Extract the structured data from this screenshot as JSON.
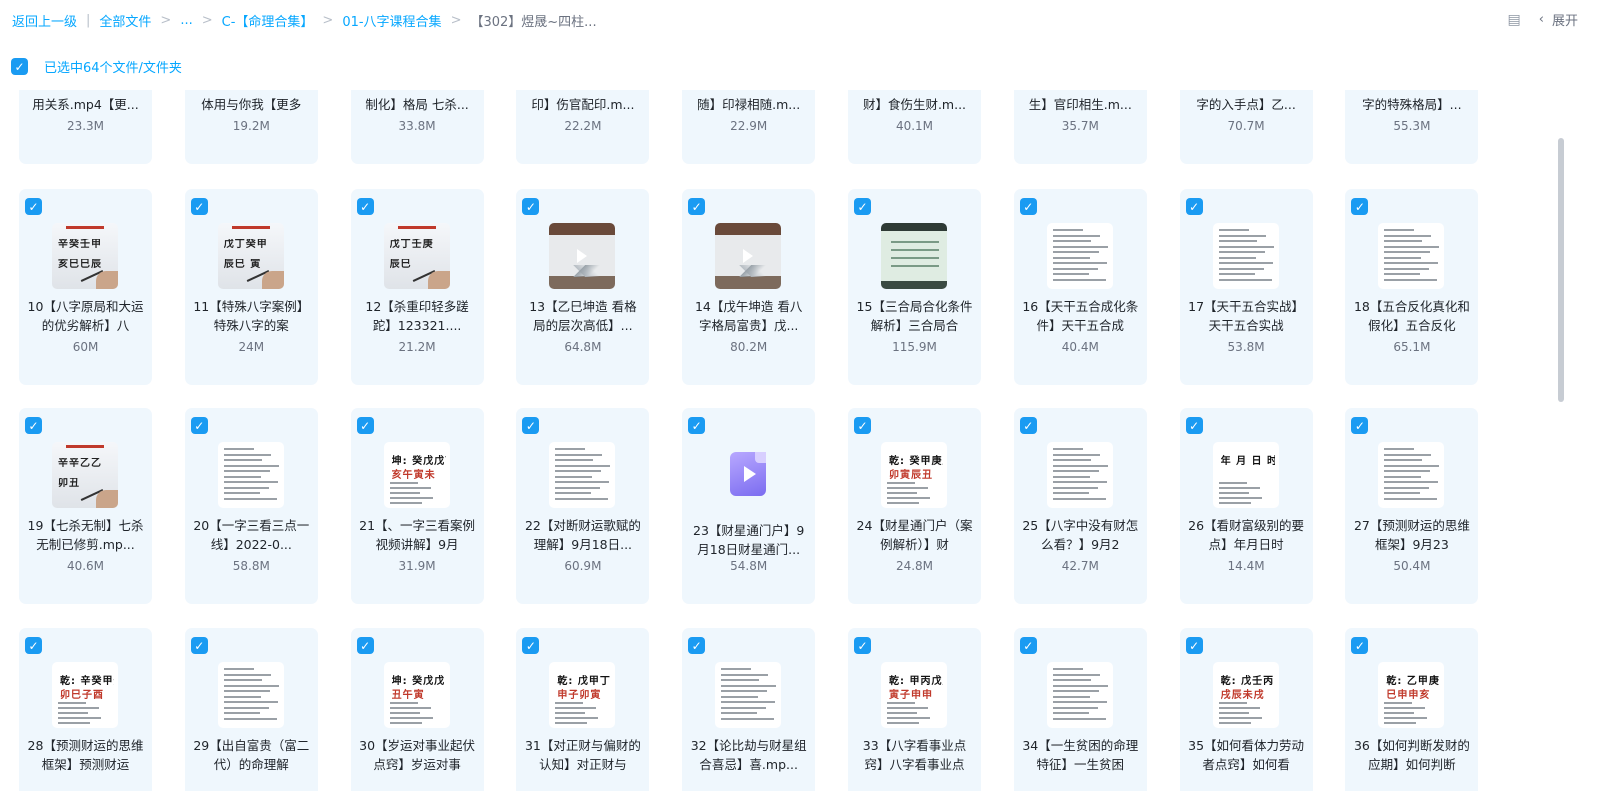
{
  "breadcrumb": {
    "back": "返回上一级",
    "items": [
      "全部文件",
      "...",
      "C-【命理合集】",
      "01-八字课程合集",
      "【302】煜晟~四柱..."
    ]
  },
  "toolbar": {
    "expand_label": "展开",
    "layout_icon": "layout-icon",
    "chevron_icon": "chevron-left-icon"
  },
  "selection": {
    "text": "已选中64个文件/文件夹",
    "checked": true
  },
  "colors": {
    "accent": "#06a7ff",
    "checkbox": "#1a9bf2",
    "card_bg": "#eff7fd"
  },
  "partial_row": [
    {
      "name": "用关系.mp4【更...",
      "size": "23.3M"
    },
    {
      "name": "体用与你我【更多",
      "size": "19.2M"
    },
    {
      "name": "制化】格局 七杀...",
      "size": "33.8M"
    },
    {
      "name": "印】伤官配印.m...",
      "size": "22.2M"
    },
    {
      "name": "随】印禄相随.m...",
      "size": "22.9M"
    },
    {
      "name": "财】食伤生财.m...",
      "size": "40.1M"
    },
    {
      "name": "生】官印相生.m...",
      "size": "35.7M"
    },
    {
      "name": "字的入手点】乙...",
      "size": "70.7M"
    },
    {
      "name": "字的特殊格局】...",
      "size": "55.3M"
    }
  ],
  "rows": [
    [
      {
        "name": "10【八字原局和大运的优劣解析】八",
        "size": "60M",
        "thumb": "board",
        "lines": [
          "辛癸壬甲",
          "亥巳巳辰"
        ]
      },
      {
        "name": "11【特殊八字案例】特殊八字的案",
        "size": "24M",
        "thumb": "board",
        "lines": [
          "戊丁癸甲",
          "辰巳 寅"
        ]
      },
      {
        "name": "12【杀重印轻多蹉跎】123321....",
        "size": "21.2M",
        "thumb": "board",
        "lines": [
          "戊丁壬庚",
          "辰巳"
        ]
      },
      {
        "name": "13【乙巳坤造 看格局的层次高低】...",
        "size": "64.8M",
        "thumb": "room"
      },
      {
        "name": "14【戊午坤造 看八字格局富贵】戊...",
        "size": "80.2M",
        "thumb": "room"
      },
      {
        "name": "15【三合局合化条件解析】三合局合",
        "size": "115.9M",
        "thumb": "green"
      },
      {
        "name": "16【天干五合成化条件】天干五合成",
        "size": "40.4M",
        "thumb": "doc"
      },
      {
        "name": "17【天干五合实战】天干五合实战",
        "size": "53.8M",
        "thumb": "doc"
      },
      {
        "name": "18【五合反化真化和假化】五合反化",
        "size": "65.1M",
        "thumb": "doc"
      }
    ],
    [
      {
        "name": "19【七杀无制】七杀无制已修剪.mp...",
        "size": "40.6M",
        "thumb": "board",
        "lines": [
          "辛辛乙乙",
          "卯丑"
        ]
      },
      {
        "name": "20【一字三看三点一线】2022-0...",
        "size": "58.8M",
        "thumb": "doc"
      },
      {
        "name": "21【、一字三看案例视频讲解】9月",
        "size": "31.9M",
        "thumb": "bigdoc",
        "lines": [
          "坤: 癸戊戊丁",
          "亥午寅未"
        ]
      },
      {
        "name": "22【对断财运歌赋的理解】9月18日...",
        "size": "60.9M",
        "thumb": "doc"
      },
      {
        "name": "23【财星通门户】9月18日财星通门...",
        "size": "54.8M",
        "thumb": "video"
      },
      {
        "name": "24【财星通门户（案例解析）】财",
        "size": "24.8M",
        "thumb": "bigdoc",
        "lines": [
          "乾: 癸甲庚丑",
          "卯寅辰丑"
        ]
      },
      {
        "name": "25【八字中没有财怎么看？】9月2",
        "size": "42.7M",
        "thumb": "doc"
      },
      {
        "name": "26【看财富级别的要点】年月日时",
        "size": "14.4M",
        "thumb": "bigdoc",
        "lines": [
          "年 月 日 时",
          ""
        ]
      },
      {
        "name": "27【预测财运的思维框架】9月23",
        "size": "50.4M",
        "thumb": "doc"
      }
    ],
    [
      {
        "name": "28【预测财运的思维框架】预测财运",
        "size": "",
        "thumb": "bigdoc",
        "lines": [
          "乾: 辛癸甲癸",
          "卯巳子酉"
        ]
      },
      {
        "name": "29【出自富贵（富二代）的命理解",
        "size": "",
        "thumb": "doc"
      },
      {
        "name": "30【岁运对事业起伏点窍】岁运对事",
        "size": "",
        "thumb": "bigdoc",
        "lines": [
          "坤: 癸戊戊",
          "丑午寅"
        ]
      },
      {
        "name": "31【对正财与偏财的认知】对正财与",
        "size": "",
        "thumb": "bigdoc",
        "lines": [
          "乾: 戊甲丁壬",
          "申子卯寅"
        ]
      },
      {
        "name": "32【论比劫与财星组合喜忌】喜.mp...",
        "size": "",
        "thumb": "doc"
      },
      {
        "name": "33【八字看事业点窍】八字看事业点",
        "size": "",
        "thumb": "bigdoc",
        "lines": [
          "乾: 甲丙戊庚",
          "寅子申申"
        ]
      },
      {
        "name": "34【一生贫困的命理特征】一生贫困",
        "size": "",
        "thumb": "doc"
      },
      {
        "name": "35【如何看体力劳动者点窍】如何看",
        "size": "",
        "thumb": "bigdoc",
        "lines": [
          "乾: 戊壬丙甲",
          "戌辰未戌"
        ]
      },
      {
        "name": "36【如何判断发财的应期】如何判断",
        "size": "",
        "thumb": "bigdoc",
        "lines": [
          "乾: 乙甲庚丁",
          "巳申申亥"
        ]
      }
    ]
  ]
}
